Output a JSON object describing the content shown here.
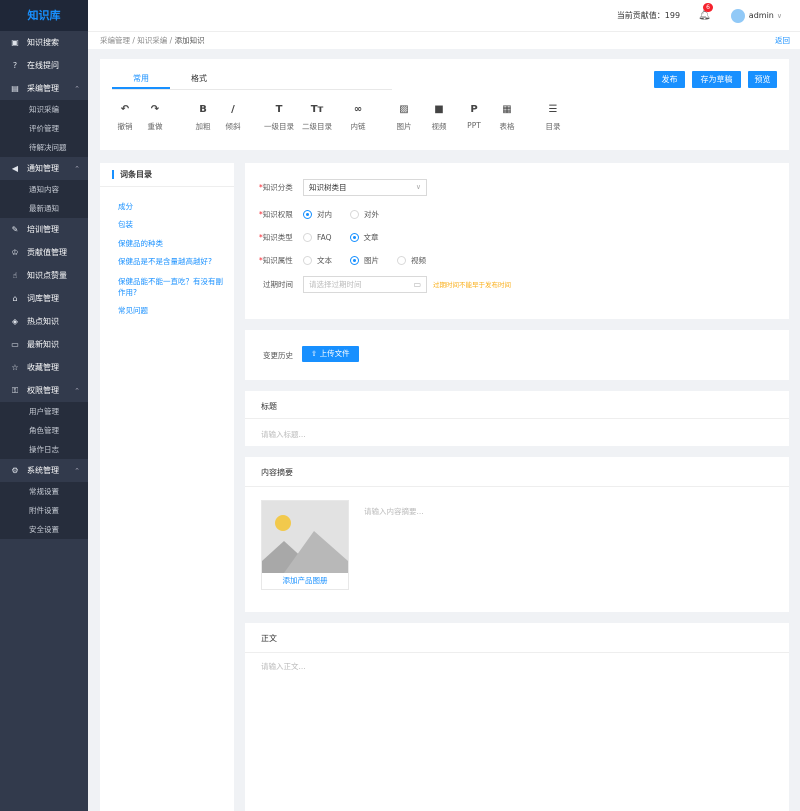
{
  "app": {
    "logo": "知识库"
  },
  "sidebar": {
    "items": [
      {
        "icon": "book-icon",
        "glyph": "▣",
        "label": "知识搜索"
      },
      {
        "icon": "question-icon",
        "glyph": "?",
        "label": "在线提问"
      },
      {
        "icon": "clipboard-icon",
        "glyph": "▤",
        "label": "采编管理",
        "arrow": "⌃",
        "children": [
          "知识采编",
          "评价管理",
          "待解决问题"
        ]
      },
      {
        "icon": "speaker-icon",
        "glyph": "◀",
        "label": "通知管理",
        "arrow": "⌃",
        "children": [
          "通知内容",
          "最新通知"
        ]
      },
      {
        "icon": "training-icon",
        "glyph": "✎",
        "label": "培训管理"
      },
      {
        "icon": "trophy-icon",
        "glyph": "♔",
        "label": "贡献值管理"
      },
      {
        "icon": "thumbs-up-icon",
        "glyph": "☝",
        "label": "知识点赞量"
      },
      {
        "icon": "home-icon",
        "glyph": "⌂",
        "label": "词库管理"
      },
      {
        "icon": "hot-icon",
        "glyph": "◈",
        "label": "热点知识"
      },
      {
        "icon": "new-icon",
        "glyph": "▭",
        "label": "最新知识"
      },
      {
        "icon": "star-icon",
        "glyph": "☆",
        "label": "收藏管理"
      },
      {
        "icon": "permission-icon",
        "glyph": "⚿",
        "label": "权限管理",
        "arrow": "⌃",
        "children": [
          "用户管理",
          "角色管理",
          "操作日志"
        ]
      },
      {
        "icon": "gear-icon",
        "glyph": "⚙",
        "label": "系统管理",
        "arrow": "⌃",
        "children": [
          "常规设置",
          "附件设置",
          "安全设置"
        ]
      }
    ]
  },
  "header": {
    "contribution": "当前贡献值：199",
    "bell_count": "6",
    "user": "admin",
    "user_arrow": "∨"
  },
  "breadcrumb": {
    "items": [
      "采编管理",
      "知识采编",
      "添加知识"
    ],
    "sep": " / ",
    "back": "返回"
  },
  "editor": {
    "tabs": [
      "常用",
      "格式"
    ],
    "buttons": {
      "publish": "发布",
      "draft": "存为草稿",
      "preview": "预览"
    },
    "tools": [
      {
        "icon": "undo-icon",
        "glyph": "↶",
        "label": "撤销"
      },
      {
        "icon": "redo-icon",
        "glyph": "↷",
        "label": "重做"
      },
      {
        "icon": "bold-icon",
        "glyph": "B",
        "label": "加粗"
      },
      {
        "icon": "italic-icon",
        "glyph": "/",
        "label": "倾斜"
      },
      {
        "icon": "heading1-icon",
        "glyph": "T",
        "label": "一级目录"
      },
      {
        "icon": "heading2-icon",
        "glyph": "Tт",
        "label": "二级目录"
      },
      {
        "icon": "link-icon",
        "glyph": "∞",
        "label": "内链"
      },
      {
        "icon": "image-icon",
        "glyph": "▨",
        "label": "图片"
      },
      {
        "icon": "video-icon",
        "glyph": "■",
        "label": "视频"
      },
      {
        "icon": "ppt-icon",
        "glyph": "P",
        "label": "PPT"
      },
      {
        "icon": "table-icon",
        "glyph": "▦",
        "label": "表格"
      },
      {
        "icon": "toc-icon",
        "glyph": "☰",
        "label": "目录"
      }
    ]
  },
  "toc": {
    "title": "词条目录",
    "items": [
      "成分",
      "包装",
      "保健品的种类",
      "保健品是不是含量越高越好?",
      "保健品能不能一直吃？有没有副作用?",
      "常见问题"
    ]
  },
  "form": {
    "category": {
      "label": "知识分类",
      "value": "知识树类目",
      "arrow": "∨"
    },
    "scope": {
      "label": "知识权限",
      "options": [
        "对内",
        "对外"
      ],
      "selected": 0
    },
    "type": {
      "label": "知识类型",
      "options": [
        "FAQ",
        "文章"
      ],
      "selected": 1
    },
    "attr": {
      "label": "知识属性",
      "options": [
        "文本",
        "图片",
        "视频"
      ],
      "selected": 1
    },
    "expire": {
      "label": "过期时间",
      "placeholder": "请选择过期时间",
      "warn": "过期时间不能早于发布时间"
    }
  },
  "history": {
    "label": "变更历史",
    "upload": "上传文件"
  },
  "title_section": {
    "title": "标题",
    "placeholder": "请输入标题..."
  },
  "summary": {
    "title": "内容摘要",
    "placeholder": "请输入内容摘要...",
    "image_caption": "添加产品图册"
  },
  "body": {
    "title": "正文",
    "placeholder": "请输入正文..."
  },
  "colors": {
    "accent": "#1890ff",
    "sidebar": "#323a4c",
    "sidebar_sub": "#262d3c",
    "warning": "#faad14",
    "danger": "#f5222d"
  }
}
